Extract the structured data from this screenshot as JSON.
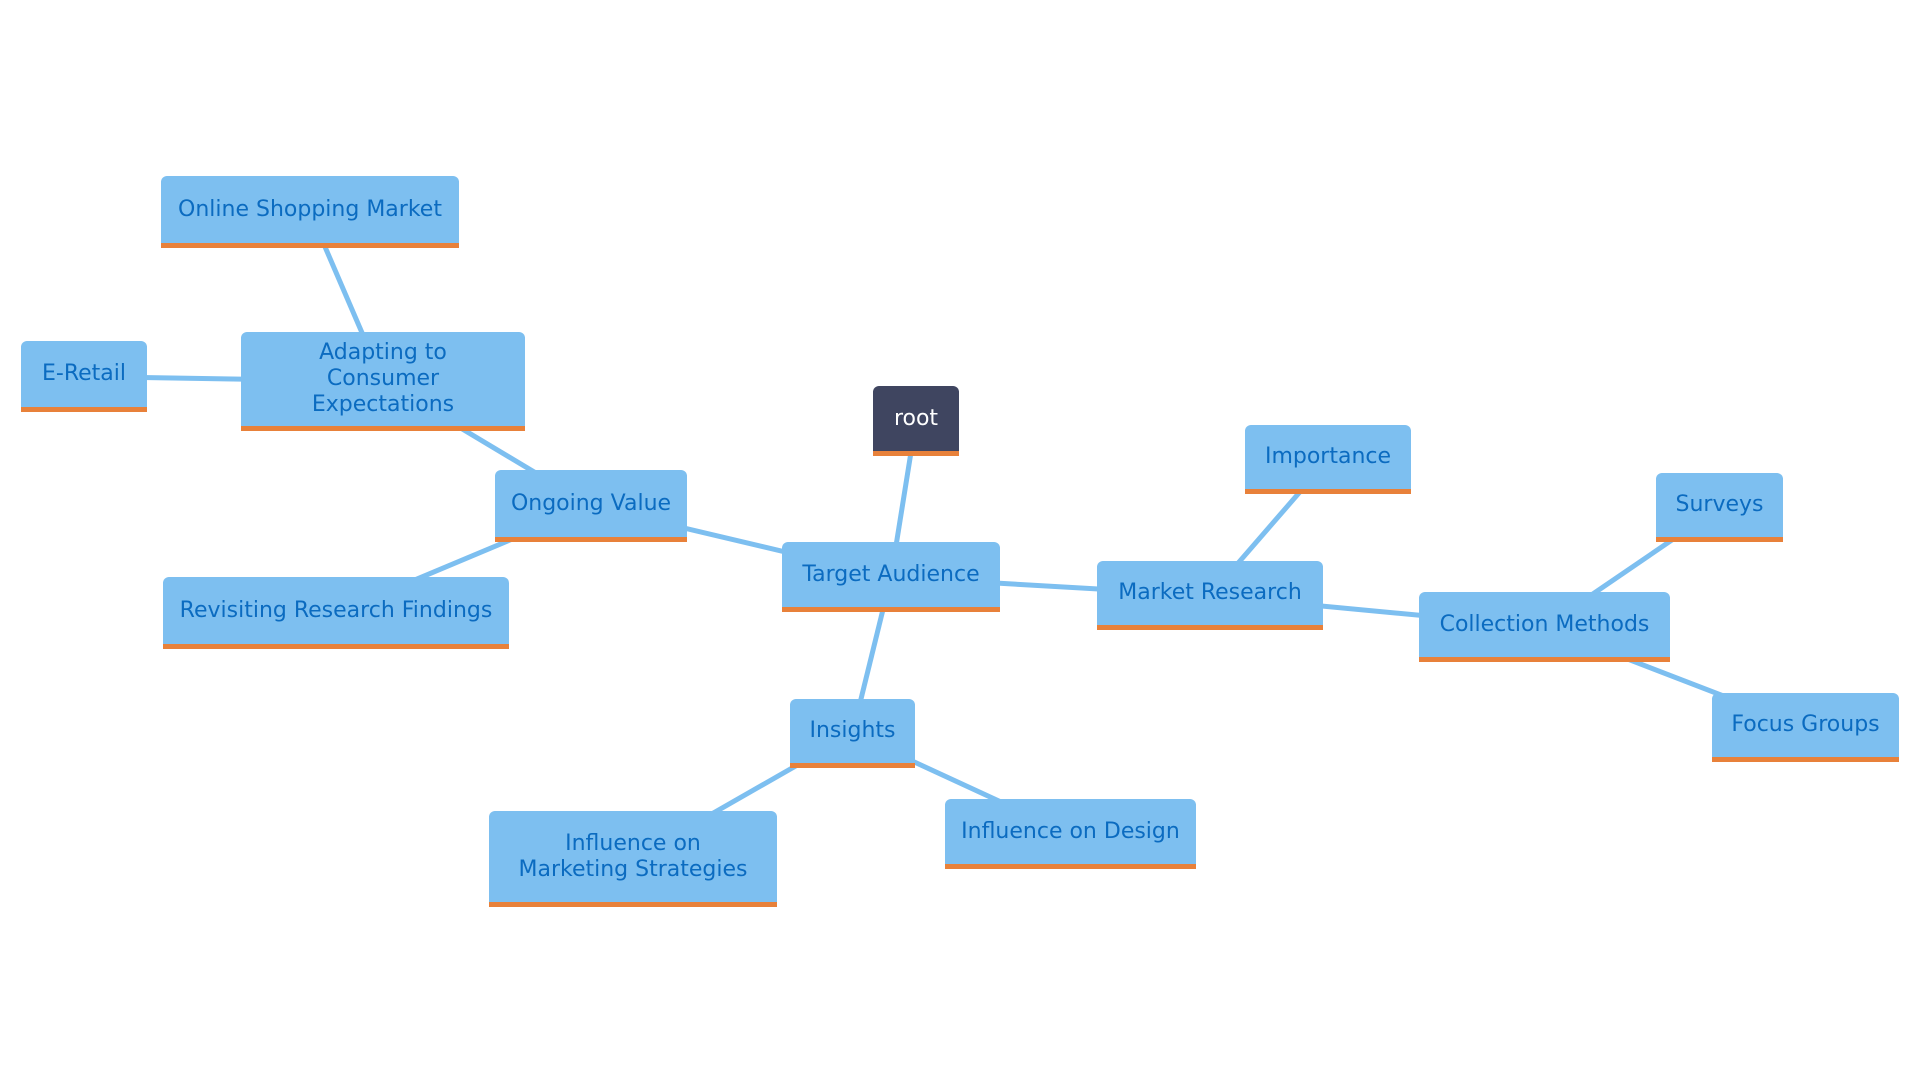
{
  "diagram": {
    "type": "mindmap",
    "colors": {
      "node_fill": "#7dbff0",
      "node_text": "#0b6bc0",
      "node_accent": "#e8813a",
      "root_fill": "#3f4560",
      "root_text": "#ffffff",
      "edge": "#7dbff0"
    },
    "nodes": [
      {
        "id": "root",
        "label": "root"
      },
      {
        "id": "target",
        "label": "Target Audience"
      },
      {
        "id": "market",
        "label": "Market Research"
      },
      {
        "id": "importance",
        "label": "Importance"
      },
      {
        "id": "collection",
        "label": "Collection Methods"
      },
      {
        "id": "surveys",
        "label": "Surveys"
      },
      {
        "id": "focus",
        "label": "Focus Groups"
      },
      {
        "id": "insights",
        "label": "Insights"
      },
      {
        "id": "marketing",
        "label": "Influence on Marketing Strategies"
      },
      {
        "id": "design",
        "label": "Influence on Design"
      },
      {
        "id": "ongoing",
        "label": "Ongoing Value"
      },
      {
        "id": "revisiting",
        "label": "Revisiting Research Findings"
      },
      {
        "id": "adapting",
        "label": "Adapting to Consumer Expectations"
      },
      {
        "id": "eretail",
        "label": "E-Retail"
      },
      {
        "id": "online",
        "label": "Online Shopping Market"
      }
    ],
    "edges": [
      [
        "root",
        "target"
      ],
      [
        "target",
        "market"
      ],
      [
        "market",
        "importance"
      ],
      [
        "market",
        "collection"
      ],
      [
        "collection",
        "surveys"
      ],
      [
        "collection",
        "focus"
      ],
      [
        "target",
        "insights"
      ],
      [
        "insights",
        "marketing"
      ],
      [
        "insights",
        "design"
      ],
      [
        "target",
        "ongoing"
      ],
      [
        "ongoing",
        "revisiting"
      ],
      [
        "ongoing",
        "adapting"
      ],
      [
        "adapting",
        "eretail"
      ],
      [
        "adapting",
        "online"
      ]
    ]
  }
}
